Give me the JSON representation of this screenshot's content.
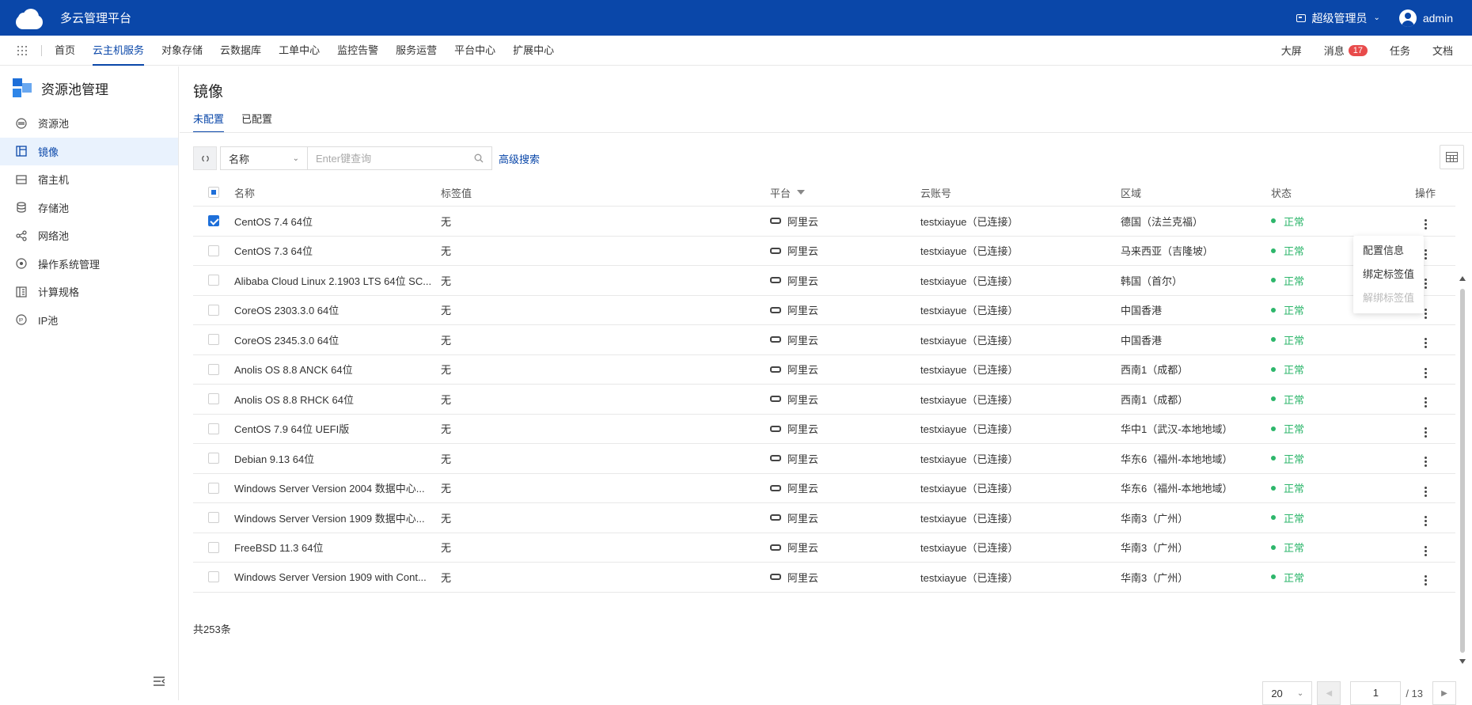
{
  "app": {
    "brand": "多云管理平台",
    "role": "超级管理员",
    "user": "admin"
  },
  "menubar": {
    "items": [
      "首页",
      "云主机服务",
      "对象存储",
      "云数据库",
      "工单中心",
      "监控告警",
      "服务运营",
      "平台中心",
      "扩展中心"
    ],
    "active_index": 1,
    "right": {
      "screen": "大屏",
      "messages": "消息",
      "message_count": "17",
      "tasks": "任务",
      "docs": "文档"
    }
  },
  "sidebar": {
    "title": "资源池管理",
    "items": [
      {
        "label": "资源池",
        "icon": "resource-pool-icon"
      },
      {
        "label": "镜像",
        "icon": "image-icon",
        "active": true
      },
      {
        "label": "宿主机",
        "icon": "host-icon"
      },
      {
        "label": "存储池",
        "icon": "storage-icon"
      },
      {
        "label": "网络池",
        "icon": "network-icon"
      },
      {
        "label": "操作系统管理",
        "icon": "os-icon"
      },
      {
        "label": "计算规格",
        "icon": "compute-spec-icon"
      },
      {
        "label": "IP池",
        "icon": "ip-pool-icon"
      }
    ]
  },
  "page": {
    "title": "镜像",
    "tabs": [
      "未配置",
      "已配置"
    ],
    "active_tab": 0
  },
  "toolbar": {
    "field_select": "名称",
    "search_placeholder": "Enter键查询",
    "advanced_search": "高级搜索"
  },
  "table": {
    "columns": {
      "name": "名称",
      "tag": "标签值",
      "platform": "平台",
      "account": "云账号",
      "region": "区域",
      "status": "状态",
      "ops": "操作"
    },
    "rows": [
      {
        "name": "CentOS 7.4 64位",
        "tag": "无",
        "platform": "阿里云",
        "account": "testxiayue（已连接）",
        "region": "德国（法兰克福）",
        "status": "正常",
        "checked": true
      },
      {
        "name": "CentOS 7.3 64位",
        "tag": "无",
        "platform": "阿里云",
        "account": "testxiayue（已连接）",
        "region": "马来西亚（吉隆坡）",
        "status": "正常"
      },
      {
        "name": "Alibaba Cloud Linux 2.1903 LTS 64位 SC...",
        "tag": "无",
        "platform": "阿里云",
        "account": "testxiayue（已连接）",
        "region": "韩国（首尔）",
        "status": "正常"
      },
      {
        "name": "CoreOS 2303.3.0 64位",
        "tag": "无",
        "platform": "阿里云",
        "account": "testxiayue（已连接）",
        "region": "中国香港",
        "status": "正常"
      },
      {
        "name": "CoreOS 2345.3.0 64位",
        "tag": "无",
        "platform": "阿里云",
        "account": "testxiayue（已连接）",
        "region": "中国香港",
        "status": "正常"
      },
      {
        "name": "Anolis OS 8.8 ANCK 64位",
        "tag": "无",
        "platform": "阿里云",
        "account": "testxiayue（已连接）",
        "region": "西南1（成都）",
        "status": "正常"
      },
      {
        "name": "Anolis OS 8.8 RHCK 64位",
        "tag": "无",
        "platform": "阿里云",
        "account": "testxiayue（已连接）",
        "region": "西南1（成都）",
        "status": "正常"
      },
      {
        "name": "CentOS 7.9 64位 UEFI版",
        "tag": "无",
        "platform": "阿里云",
        "account": "testxiayue（已连接）",
        "region": "华中1（武汉-本地地域）",
        "status": "正常"
      },
      {
        "name": "Debian 9.13 64位",
        "tag": "无",
        "platform": "阿里云",
        "account": "testxiayue（已连接）",
        "region": "华东6（福州-本地地域）",
        "status": "正常"
      },
      {
        "name": "Windows Server Version 2004 数据中心...",
        "tag": "无",
        "platform": "阿里云",
        "account": "testxiayue（已连接）",
        "region": "华东6（福州-本地地域）",
        "status": "正常"
      },
      {
        "name": "Windows Server Version 1909 数据中心...",
        "tag": "无",
        "platform": "阿里云",
        "account": "testxiayue（已连接）",
        "region": "华南3（广州）",
        "status": "正常"
      },
      {
        "name": "FreeBSD 11.3 64位",
        "tag": "无",
        "platform": "阿里云",
        "account": "testxiayue（已连接）",
        "region": "华南3（广州）",
        "status": "正常"
      },
      {
        "name": "Windows Server Version 1909 with Cont...",
        "tag": "无",
        "platform": "阿里云",
        "account": "testxiayue（已连接）",
        "region": "华南3（广州）",
        "status": "正常"
      }
    ]
  },
  "dropdown": {
    "items": [
      "配置信息",
      "绑定标签值",
      "解绑标签值"
    ],
    "disabled_index": 2
  },
  "footer": {
    "total": "共253条",
    "page_size": "20",
    "current_page": "1",
    "total_pages": "/ 13"
  },
  "colors": {
    "brand": "#0a47a9",
    "status_ok": "#2db66b",
    "badge": "#e84b4b"
  }
}
